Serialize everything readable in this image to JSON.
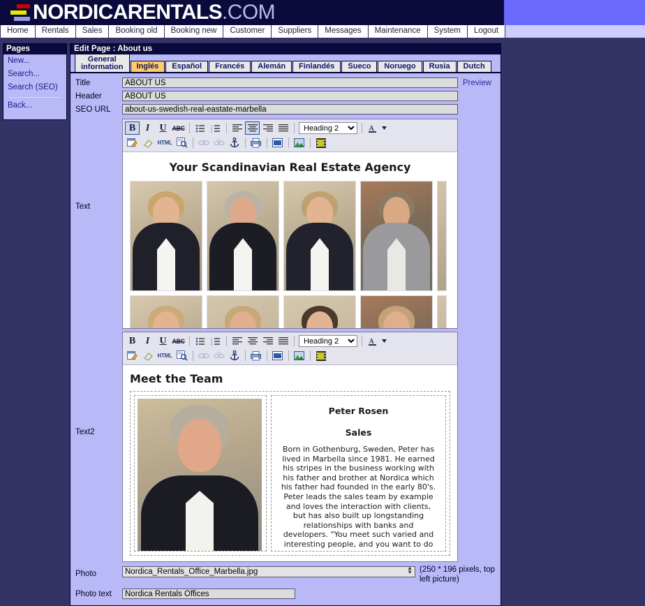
{
  "header": {
    "brand_main": "NORDICARENTALS",
    "brand_suffix": ".COM",
    "logo_icon": "nordic-flag-bars-logo",
    "colors": {
      "dark": "#0a0a3c",
      "accent_blue": "#6a6aff",
      "lavender": "#ccccff"
    }
  },
  "nav": {
    "items": [
      {
        "label": "Home"
      },
      {
        "label": "Rentals"
      },
      {
        "label": "Sales"
      },
      {
        "label": "Booking old"
      },
      {
        "label": "Booking new"
      },
      {
        "label": "Customer"
      },
      {
        "label": "Suppliers"
      },
      {
        "label": "Messages"
      },
      {
        "label": "Maintenance"
      },
      {
        "label": "System"
      },
      {
        "label": "Logout"
      }
    ]
  },
  "sidebar": {
    "title": "Pages",
    "items": [
      {
        "label": "New..."
      },
      {
        "label": "Search..."
      },
      {
        "label": "Search (SEO)"
      },
      {
        "label": "Back..."
      }
    ]
  },
  "panel": {
    "title": "Edit Page : About us",
    "preview_label": "Preview"
  },
  "tabs": [
    {
      "label": "General information",
      "active": false,
      "two_line": true
    },
    {
      "label": "Inglés",
      "active": true
    },
    {
      "label": "Español",
      "active": false
    },
    {
      "label": "Francés",
      "active": false
    },
    {
      "label": "Alemán",
      "active": false
    },
    {
      "label": "Finlandés",
      "active": false
    },
    {
      "label": "Sueco",
      "active": false
    },
    {
      "label": "Noruego",
      "active": false
    },
    {
      "label": "Rusia",
      "active": false
    },
    {
      "label": "Dutch",
      "active": false
    }
  ],
  "form": {
    "title_label": "Title",
    "title_value": "ABOUT US",
    "header_label": "Header",
    "header_value": "ABOUT US",
    "seo_label": "SEO URL",
    "seo_value": "about-us-swedish-real-eastate-marbella",
    "text_label": "Text",
    "text2_label": "Text2",
    "photo_label": "Photo",
    "photo_value": "Nordica_Rentals_Office_Marbella.jpg",
    "photo_note": "(250 * 196 pixels, top left picture)",
    "phototext_label": "Photo text",
    "phototext_value": "Nordica Rentals Offices"
  },
  "toolbar": {
    "format_value": "Heading 2",
    "buttons_row1": [
      {
        "name": "bold",
        "glyph": "B"
      },
      {
        "name": "italic",
        "glyph": "I"
      },
      {
        "name": "underline",
        "glyph": "U"
      },
      {
        "name": "strikethrough",
        "glyph": "ABC"
      },
      {
        "name": "bulleted-list",
        "glyph": ""
      },
      {
        "name": "numbered-list",
        "glyph": ""
      },
      {
        "name": "align-left",
        "glyph": ""
      },
      {
        "name": "align-center",
        "glyph": ""
      },
      {
        "name": "align-right",
        "glyph": ""
      },
      {
        "name": "justify",
        "glyph": ""
      },
      {
        "name": "text-color",
        "glyph": "A"
      }
    ],
    "buttons_row2": [
      {
        "name": "edit-table",
        "glyph": ""
      },
      {
        "name": "eraser",
        "glyph": ""
      },
      {
        "name": "html-source",
        "glyph": "HTML"
      },
      {
        "name": "preview-magnifier",
        "glyph": ""
      },
      {
        "name": "insert-link",
        "glyph": ""
      },
      {
        "name": "unlink",
        "glyph": ""
      },
      {
        "name": "anchor",
        "glyph": ""
      },
      {
        "name": "print",
        "glyph": ""
      },
      {
        "name": "page-break",
        "glyph": ""
      },
      {
        "name": "insert-image",
        "glyph": ""
      },
      {
        "name": "insert-flash",
        "glyph": ""
      }
    ]
  },
  "content": {
    "text_heading": "Your Scandinavian Real Estate Agency",
    "photo_grid_count": 10,
    "text2_heading": "Meet the Team",
    "team": {
      "name": "Peter Rosen",
      "role": "Sales",
      "bio": "Born in Gothenburg, Sweden, Peter has lived in Marbella since 1981. He earned his stripes in the business working with his father and brother at Nordica which his father had founded in the early 80's. Peter leads the sales team by example and loves the interaction with clients, but has also built up longstanding relationships with banks and developers. \"You meet such varied and interesting people, and you want to do right by them so we only source properties that we would be confident to sell on for them again.\""
    }
  }
}
